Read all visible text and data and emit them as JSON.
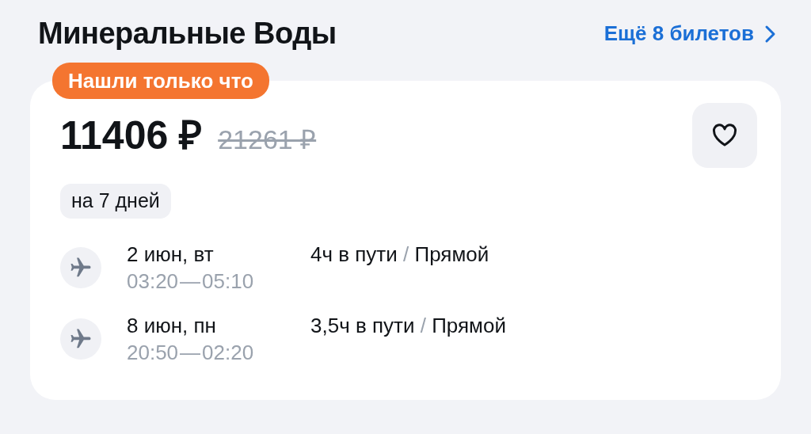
{
  "header": {
    "title": "Минеральные Воды",
    "more_link": "Ещё 8 билетов"
  },
  "card": {
    "badge": "Нашли только что",
    "price": "11406 ₽",
    "old_price": "21261 ₽",
    "tag": "на 7 дней",
    "flights": [
      {
        "date": "2 июн, вт",
        "departure": "03:20",
        "time_separator": "—",
        "arrival": "05:10",
        "duration": "4ч в пути",
        "separator": "/",
        "type": "Прямой"
      },
      {
        "date": "8 июн, пн",
        "departure": "20:50",
        "time_separator": "—",
        "arrival": "02:20",
        "duration": "3,5ч в пути",
        "separator": "/",
        "type": "Прямой"
      }
    ]
  }
}
